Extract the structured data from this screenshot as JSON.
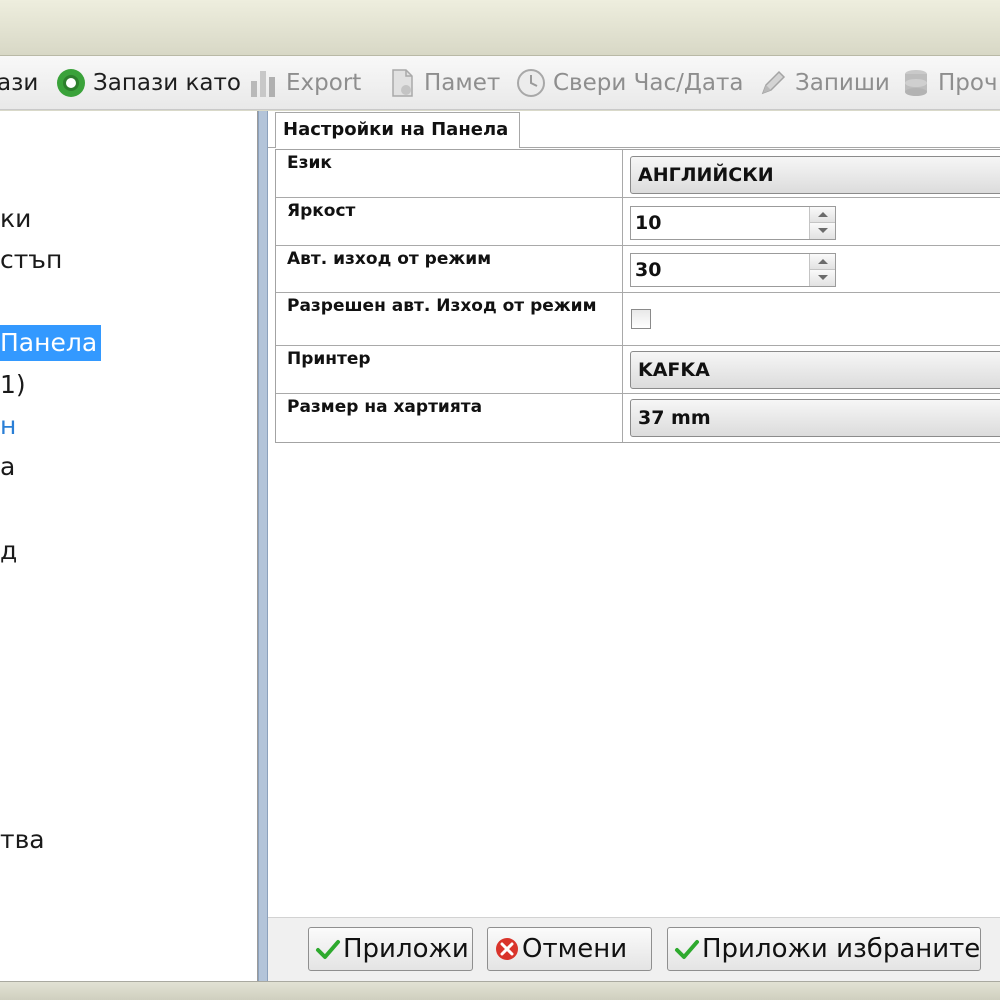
{
  "toolbar": {
    "items": [
      {
        "label": "ази",
        "icon": "save-icon",
        "enabled": true
      },
      {
        "label": "Запази като",
        "icon": "save-as-icon",
        "enabled": true
      },
      {
        "label": "Export",
        "icon": "export-chart-icon",
        "enabled": false
      },
      {
        "label": "Памет",
        "icon": "memory-document-icon",
        "enabled": false
      },
      {
        "label": "Свери Час/Дата",
        "icon": "clock-icon",
        "enabled": false
      },
      {
        "label": "Запиши",
        "icon": "pencil-icon",
        "enabled": false
      },
      {
        "label": "Проч",
        "icon": "database-icon",
        "enabled": false
      }
    ]
  },
  "sidebar": {
    "items": [
      {
        "label": "ки"
      },
      {
        "label": "стъп"
      },
      {
        "label": "Панела",
        "selected": true
      },
      {
        "label": "1)"
      },
      {
        "label": "н"
      },
      {
        "label": "а"
      },
      {
        "label": "д"
      },
      {
        "label": "тва"
      }
    ]
  },
  "panel": {
    "tab_label": "Настройки на Панела",
    "rows": {
      "language": {
        "label": "Език",
        "value": "АНГЛИЙСКИ"
      },
      "brightness": {
        "label": "Яркост",
        "value": "10"
      },
      "auto_exit": {
        "label": "Авт. изход от режим",
        "value": "30"
      },
      "auto_exit_enabled": {
        "label": "Разрешен авт. Изход от режим",
        "checked": false
      },
      "printer": {
        "label": "Принтер",
        "value": "KAFKA"
      },
      "paper_size": {
        "label": "Размер на хартията",
        "value": "37 mm"
      }
    }
  },
  "buttons": {
    "apply": "Приложи",
    "cancel": "Отмени",
    "apply_selected": "Приложи избраните"
  },
  "colors": {
    "selection": "#3399ff",
    "link": "#2a7fd6",
    "apply_check": "#2eaa2e",
    "cancel_icon": "#d9342b",
    "save_icon": "#3aa23a"
  }
}
